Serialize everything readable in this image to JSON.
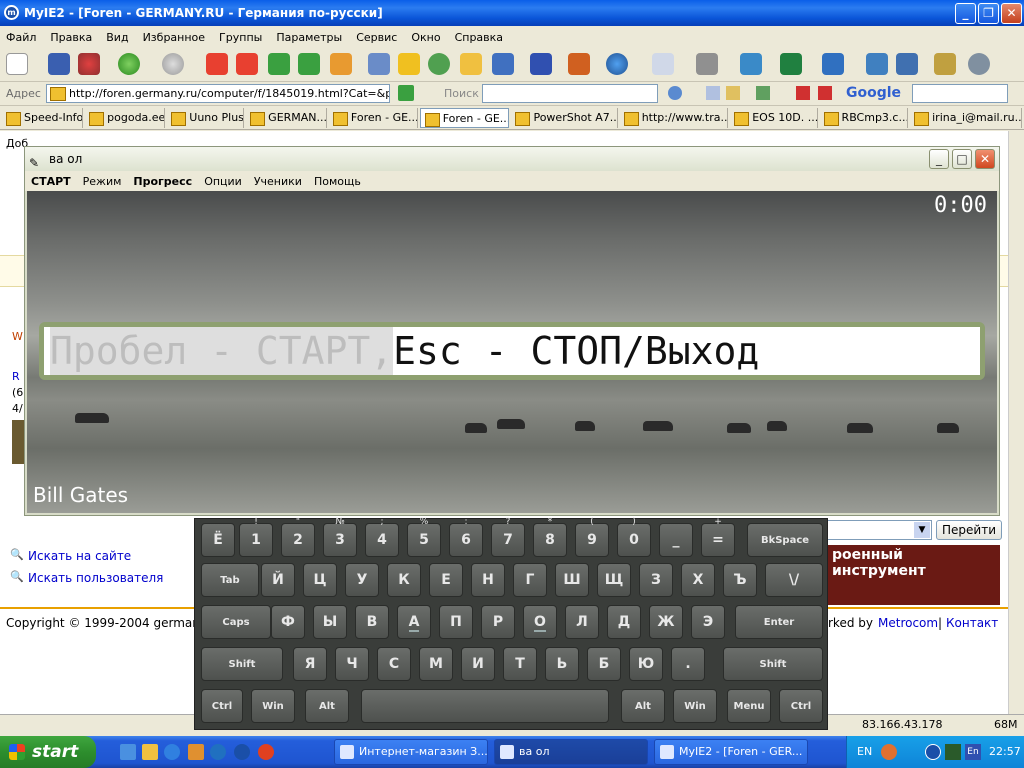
{
  "ie": {
    "title": "MyIE2 - [Foren - GERMANY.RU - Германия по-русски]",
    "menu": [
      "Файл",
      "Правка",
      "Вид",
      "Избранное",
      "Группы",
      "Параметры",
      "Сервис",
      "Окно",
      "Справка"
    ],
    "address_label": "Адрес",
    "address": "http://foren.germany.ru/computer/f/1845019.html?Cat=&page",
    "search_label": "Поиск",
    "google_label": "Google",
    "tabs": [
      "Speed-Info",
      "pogoda.ee",
      "Uuno Plus",
      "GERMAN...",
      "Foren - GE...",
      "Foren - GE...",
      "PowerShot A7...",
      "http://www.tra...",
      "EOS 10D. ...",
      "RBCmp3.c...",
      "irina_i@mail.ru..."
    ]
  },
  "page": {
    "sub_text": "Доб",
    "search_site": "Искать на сайте",
    "search_user": "Искать пользователя",
    "copyright": "Copyright © 1999-2004 germany.r",
    "ad_text": "роенный инструмент",
    "go_button": "Перейти",
    "networked_by": "rked by",
    "metrocom": "Metrocom",
    "separator": "|",
    "contact": "Контакт",
    "side_letters": "W",
    "side_r": "R",
    "side_6": "(6",
    "side_4": "4/"
  },
  "status": {
    "ip": "83.166.43.178",
    "mem": "68M"
  },
  "app": {
    "title": "ва ол",
    "menu": [
      "СТАРТ",
      "Режим",
      "Прогресс",
      "Опции",
      "Ученики",
      "Помощь"
    ],
    "timer": "0:00",
    "typed_text": "Пробел - СТАРТ, ",
    "remaining_text": "Esc - СТОП/Выход",
    "author": "Bill Gates"
  },
  "keyboard": {
    "row1": [
      [
        "Ё",
        ""
      ],
      [
        "1",
        "!"
      ],
      [
        "2",
        "\""
      ],
      [
        "3",
        "№"
      ],
      [
        "4",
        ";"
      ],
      [
        "5",
        "%"
      ],
      [
        "6",
        ":"
      ],
      [
        "7",
        "?"
      ],
      [
        "8",
        "*"
      ],
      [
        "9",
        "("
      ],
      [
        "0",
        ")"
      ],
      [
        "_",
        ""
      ],
      [
        "=",
        "+"
      ],
      [
        "BkSpace",
        ""
      ]
    ],
    "row2": [
      "Tab",
      "Й",
      "Ц",
      "У",
      "К",
      "Е",
      "Н",
      "Г",
      "Ш",
      "Щ",
      "З",
      "Х",
      "Ъ",
      "\\/"
    ],
    "row3": [
      "Caps",
      "Ф",
      "Ы",
      "В",
      "А",
      "П",
      "Р",
      "О",
      "Л",
      "Д",
      "Ж",
      "Э",
      "Enter"
    ],
    "row4": [
      "Shift",
      "Я",
      "Ч",
      "С",
      "М",
      "И",
      "Т",
      "Ь",
      "Б",
      "Ю",
      ".",
      "Shift"
    ],
    "row5": [
      "Ctrl",
      "Win",
      "Alt",
      "",
      "Alt",
      "Win",
      "Menu",
      "Ctrl"
    ]
  },
  "taskbar": {
    "start": "start",
    "tasks": [
      "Интернет-магазин З...",
      "ва ол",
      "MyIE2 - [Foren - GER..."
    ],
    "lang": "EN",
    "lang2": "En",
    "clock": "22:57"
  }
}
